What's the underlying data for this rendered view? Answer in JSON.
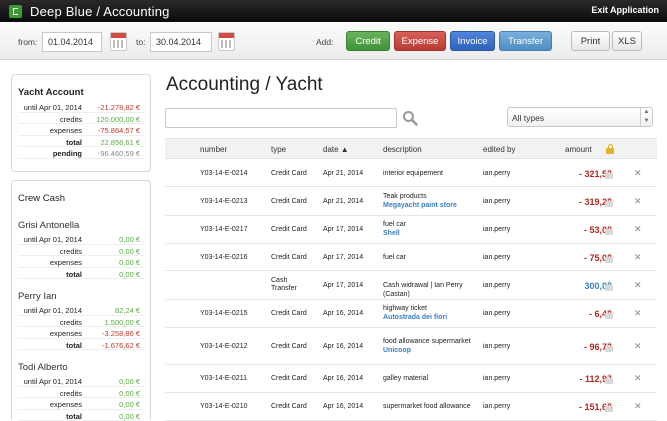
{
  "app": {
    "title": "Deep Blue / Accounting",
    "exit_label": "Exit Application"
  },
  "toolbar": {
    "from_label": "from:",
    "from_value": "01.04.2014",
    "to_label": "to:",
    "to_value": "30.04.2014",
    "add_label": "Add:",
    "credit": "Credit",
    "expense": "Expense",
    "invoice": "Invoice",
    "transfer": "Transfer",
    "print": "Print",
    "xls": "XLS"
  },
  "yacht_account": {
    "title": "Yacht Account",
    "rows": [
      {
        "label": "until Apr 01, 2014",
        "value": "-21.278,82 €",
        "tone": "neg"
      },
      {
        "label": "credits",
        "value": "120.000,00 €",
        "tone": "pos"
      },
      {
        "label": "expenses",
        "value": "-75.864,57 €",
        "tone": "neg"
      },
      {
        "label": "total",
        "value": "22.856,61 €",
        "tone": "pos"
      },
      {
        "label": "pending",
        "value": "-96.460,59 €",
        "tone": "gry"
      }
    ]
  },
  "crew_cash": {
    "title": "Crew Cash",
    "people": [
      {
        "name": "Grisi Antonella",
        "rows": [
          {
            "label": "until Apr 01, 2014",
            "value": "0,00 €",
            "tone": "pos"
          },
          {
            "label": "credits",
            "value": "0,00 €",
            "tone": "pos"
          },
          {
            "label": "expenses",
            "value": "0,00 €",
            "tone": "pos"
          },
          {
            "label": "total",
            "value": "0,00 €",
            "tone": "pos"
          }
        ]
      },
      {
        "name": "Perry Ian",
        "rows": [
          {
            "label": "until Apr 01, 2014",
            "value": "82,24 €",
            "tone": "pos"
          },
          {
            "label": "credits",
            "value": "1.500,00 €",
            "tone": "pos"
          },
          {
            "label": "expenses",
            "value": "-3.258,86 €",
            "tone": "neg"
          },
          {
            "label": "total",
            "value": "-1.676,62 €",
            "tone": "neg"
          }
        ]
      },
      {
        "name": "Todi Alberto",
        "rows": [
          {
            "label": "until Apr 01, 2014",
            "value": "0,00 €",
            "tone": "pos"
          },
          {
            "label": "credits",
            "value": "0,00 €",
            "tone": "pos"
          },
          {
            "label": "expenses",
            "value": "0,00 €",
            "tone": "pos"
          },
          {
            "label": "total",
            "value": "0,00 €",
            "tone": "pos"
          }
        ]
      }
    ]
  },
  "main": {
    "heading": "Accounting / Yacht",
    "search_placeholder": "",
    "type_filter": "All types",
    "columns": {
      "number": "number",
      "type": "type",
      "date": "date ▲",
      "description": "description",
      "edited_by": "edited by",
      "amount": "amount"
    },
    "rows": [
      {
        "number": "Y03-14-E-0214",
        "type": "Credit Card",
        "date": "Apr 21, 2014",
        "desc": "interior equipement",
        "desc_sub": "",
        "edited_by": "ian.perry",
        "amount": "- 321,52",
        "tone": "red"
      },
      {
        "number": "Y03-14-E-0213",
        "type": "Credit Card",
        "date": "Apr 21, 2014",
        "desc": "Teak products",
        "desc_sub": "Megayacht paint store",
        "edited_by": "ian.perry",
        "amount": "- 319,20",
        "tone": "red"
      },
      {
        "number": "Y03-14-E-0217",
        "type": "Credit Card",
        "date": "Apr 17, 2014",
        "desc": "fuel car",
        "desc_sub": "Shell",
        "edited_by": "ian.perry",
        "amount": "- 53,00",
        "tone": "red"
      },
      {
        "number": "Y03-14-E-0216",
        "type": "Credit Card",
        "date": "Apr 17, 2014",
        "desc": "fuel car",
        "desc_sub": "",
        "edited_by": "ian.perry",
        "amount": "- 75,00",
        "tone": "red"
      },
      {
        "number": "",
        "type": "Cash Transfer",
        "date": "Apr 17, 2014",
        "desc": "Cash widrawal | Ian Perry (Castan)",
        "desc_sub": "",
        "edited_by": "ian.perry",
        "amount": "300,00",
        "tone": "blue"
      },
      {
        "number": "Y03-14-E-0215",
        "type": "Credit Card",
        "date": "Apr 16, 2014",
        "desc": "highway ticket",
        "desc_sub": "Autostrada dei fiori",
        "edited_by": "ian.perry",
        "amount": "- 6,40",
        "tone": "red"
      },
      {
        "number": "Y03-14-E-0212",
        "type": "Credit Card",
        "date": "Apr 16, 2014",
        "desc": "food allowance supermarket",
        "desc_sub": "Unicoop",
        "edited_by": "ian.perry",
        "amount": "- 96,72",
        "tone": "red"
      },
      {
        "number": "Y03-14-E-0211",
        "type": "Credit Card",
        "date": "Apr 16, 2014",
        "desc": "galley material",
        "desc_sub": "",
        "edited_by": "ian.perry",
        "amount": "- 112,97",
        "tone": "red"
      },
      {
        "number": "Y03-14-E-0210",
        "type": "Credit Card",
        "date": "Apr 16, 2014",
        "desc": "supermarket food allowance",
        "desc_sub": "",
        "edited_by": "ian.perry",
        "amount": "- 151,60",
        "tone": "red"
      }
    ]
  }
}
